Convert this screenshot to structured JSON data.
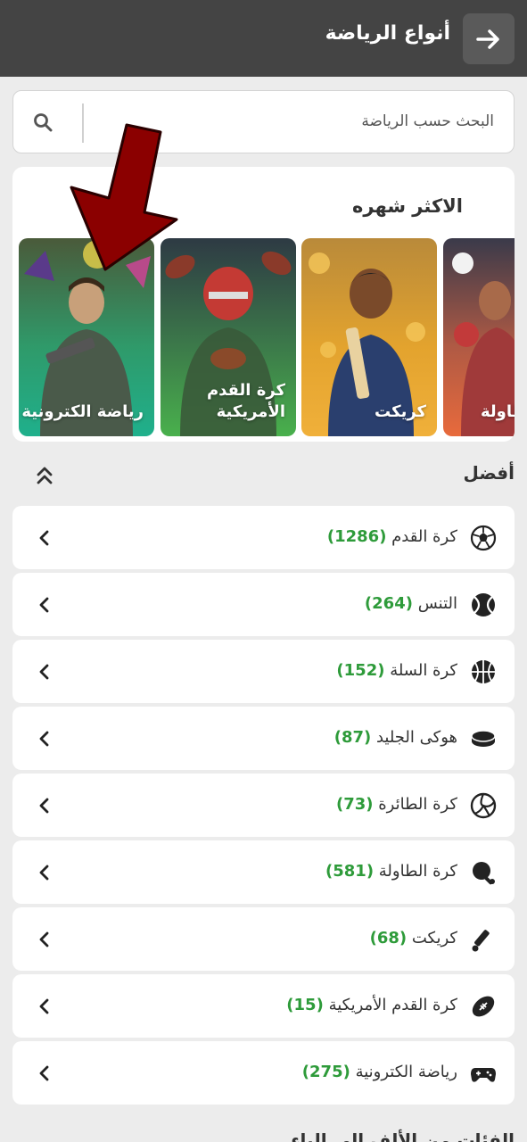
{
  "header": {
    "title": "أنواع الرياضة",
    "back_icon": "arrow-right-icon"
  },
  "search": {
    "placeholder": "البحث حسب الرياضة",
    "icon": "search-icon"
  },
  "popular": {
    "title": "الاكثر شهره",
    "cards": [
      {
        "label": "كريكت",
        "color": "#e8a62f"
      },
      {
        "label": "كرة القدم الأمريكية",
        "color": "#3aa04a"
      },
      {
        "label": "رياضة الكترونية",
        "color": "#1fae8a"
      },
      {
        "label": "كرة الطاولة",
        "color": "#e86a3c"
      }
    ]
  },
  "best": {
    "title": "أفضل",
    "items": [
      {
        "name": "كرة القدم",
        "count": "(1286)",
        "icon": "soccer-ball-icon"
      },
      {
        "name": "التنس",
        "count": "(264)",
        "icon": "tennis-ball-icon"
      },
      {
        "name": "كرة السلة",
        "count": "(152)",
        "icon": "basketball-icon"
      },
      {
        "name": "هوكى الجليد",
        "count": "(87)",
        "icon": "hockey-puck-icon"
      },
      {
        "name": "كرة الطائرة",
        "count": "(73)",
        "icon": "volleyball-icon"
      },
      {
        "name": "كرة الطاولة",
        "count": "(581)",
        "icon": "table-tennis-icon"
      },
      {
        "name": "كريكت",
        "count": "(68)",
        "icon": "cricket-icon"
      },
      {
        "name": "كرة القدم الأمريكية",
        "count": "(15)",
        "icon": "american-football-icon"
      },
      {
        "name": "رياضة الكترونية",
        "count": "(275)",
        "icon": "gamepad-icon"
      }
    ]
  },
  "next_section": {
    "title": "الفئات من الألف إلى الياء"
  },
  "colors": {
    "count_green": "#2e9b3a",
    "header_bg": "#444444"
  }
}
